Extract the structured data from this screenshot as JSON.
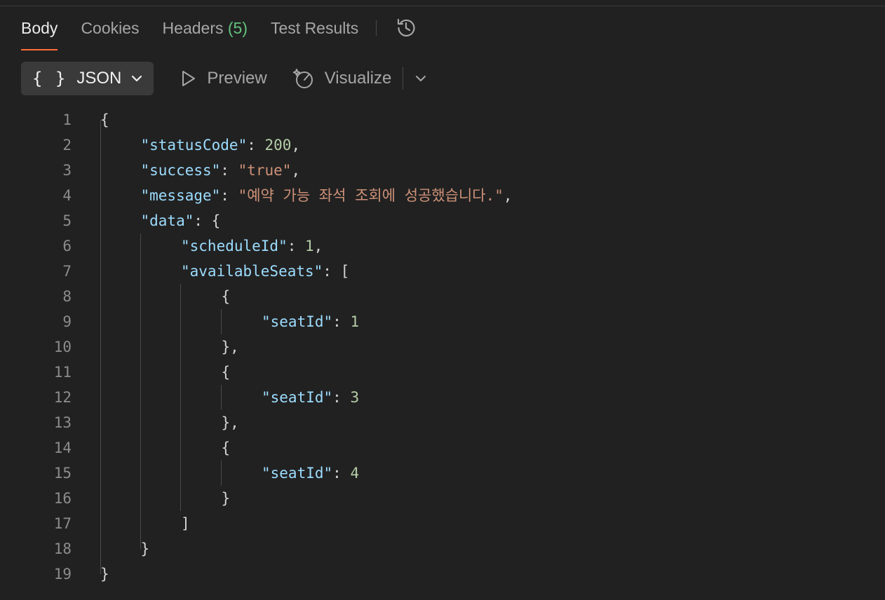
{
  "tabs": [
    {
      "label": "Body",
      "active": true
    },
    {
      "label": "Cookies",
      "active": false
    },
    {
      "label": "Headers",
      "count": "(5)",
      "active": false
    },
    {
      "label": "Test Results",
      "active": false
    }
  ],
  "toolbar": {
    "format_braces": "{ }",
    "format_label": "JSON",
    "preview_label": "Preview",
    "visualize_label": "Visualize"
  },
  "colors": {
    "accent": "#ff6c37",
    "count": "#63c27e",
    "key": "#9cdcfe",
    "number": "#b5cea8",
    "string": "#ce9178"
  },
  "icons": [
    "history-icon",
    "chevron-down-icon",
    "play-icon",
    "visualize-icon"
  ],
  "code_lines": [
    {
      "n": "1",
      "indent": 0,
      "tokens": [
        {
          "t": "pun",
          "v": "{"
        }
      ]
    },
    {
      "n": "2",
      "indent": 1,
      "tokens": [
        {
          "t": "key",
          "v": "\"statusCode\""
        },
        {
          "t": "pun",
          "v": ": "
        },
        {
          "t": "num",
          "v": "200"
        },
        {
          "t": "pun",
          "v": ","
        }
      ]
    },
    {
      "n": "3",
      "indent": 1,
      "tokens": [
        {
          "t": "key",
          "v": "\"success\""
        },
        {
          "t": "pun",
          "v": ": "
        },
        {
          "t": "str",
          "v": "\"true\""
        },
        {
          "t": "pun",
          "v": ","
        }
      ]
    },
    {
      "n": "4",
      "indent": 1,
      "tokens": [
        {
          "t": "key",
          "v": "\"message\""
        },
        {
          "t": "pun",
          "v": ": "
        },
        {
          "t": "str",
          "v": "\"예약 가능 좌석 조회에 성공했습니다.\""
        },
        {
          "t": "pun",
          "v": ","
        }
      ]
    },
    {
      "n": "5",
      "indent": 1,
      "tokens": [
        {
          "t": "key",
          "v": "\"data\""
        },
        {
          "t": "pun",
          "v": ": {"
        }
      ]
    },
    {
      "n": "6",
      "indent": 2,
      "tokens": [
        {
          "t": "key",
          "v": "\"scheduleId\""
        },
        {
          "t": "pun",
          "v": ": "
        },
        {
          "t": "num",
          "v": "1"
        },
        {
          "t": "pun",
          "v": ","
        }
      ]
    },
    {
      "n": "7",
      "indent": 2,
      "tokens": [
        {
          "t": "key",
          "v": "\"availableSeats\""
        },
        {
          "t": "pun",
          "v": ": ["
        }
      ]
    },
    {
      "n": "8",
      "indent": 3,
      "tokens": [
        {
          "t": "pun",
          "v": "{"
        }
      ]
    },
    {
      "n": "9",
      "indent": 4,
      "tokens": [
        {
          "t": "key",
          "v": "\"seatId\""
        },
        {
          "t": "pun",
          "v": ": "
        },
        {
          "t": "num",
          "v": "1"
        }
      ]
    },
    {
      "n": "10",
      "indent": 3,
      "tokens": [
        {
          "t": "pun",
          "v": "},"
        }
      ]
    },
    {
      "n": "11",
      "indent": 3,
      "tokens": [
        {
          "t": "pun",
          "v": "{"
        }
      ]
    },
    {
      "n": "12",
      "indent": 4,
      "tokens": [
        {
          "t": "key",
          "v": "\"seatId\""
        },
        {
          "t": "pun",
          "v": ": "
        },
        {
          "t": "num",
          "v": "3"
        }
      ]
    },
    {
      "n": "13",
      "indent": 3,
      "tokens": [
        {
          "t": "pun",
          "v": "},"
        }
      ]
    },
    {
      "n": "14",
      "indent": 3,
      "tokens": [
        {
          "t": "pun",
          "v": "{"
        }
      ]
    },
    {
      "n": "15",
      "indent": 4,
      "tokens": [
        {
          "t": "key",
          "v": "\"seatId\""
        },
        {
          "t": "pun",
          "v": ": "
        },
        {
          "t": "num",
          "v": "4"
        }
      ]
    },
    {
      "n": "16",
      "indent": 3,
      "tokens": [
        {
          "t": "pun",
          "v": "}"
        }
      ]
    },
    {
      "n": "17",
      "indent": 2,
      "tokens": [
        {
          "t": "pun",
          "v": "]"
        }
      ]
    },
    {
      "n": "18",
      "indent": 1,
      "tokens": [
        {
          "t": "pun",
          "v": "}"
        }
      ]
    },
    {
      "n": "19",
      "indent": 0,
      "tokens": [
        {
          "t": "pun",
          "v": "}"
        }
      ]
    }
  ]
}
